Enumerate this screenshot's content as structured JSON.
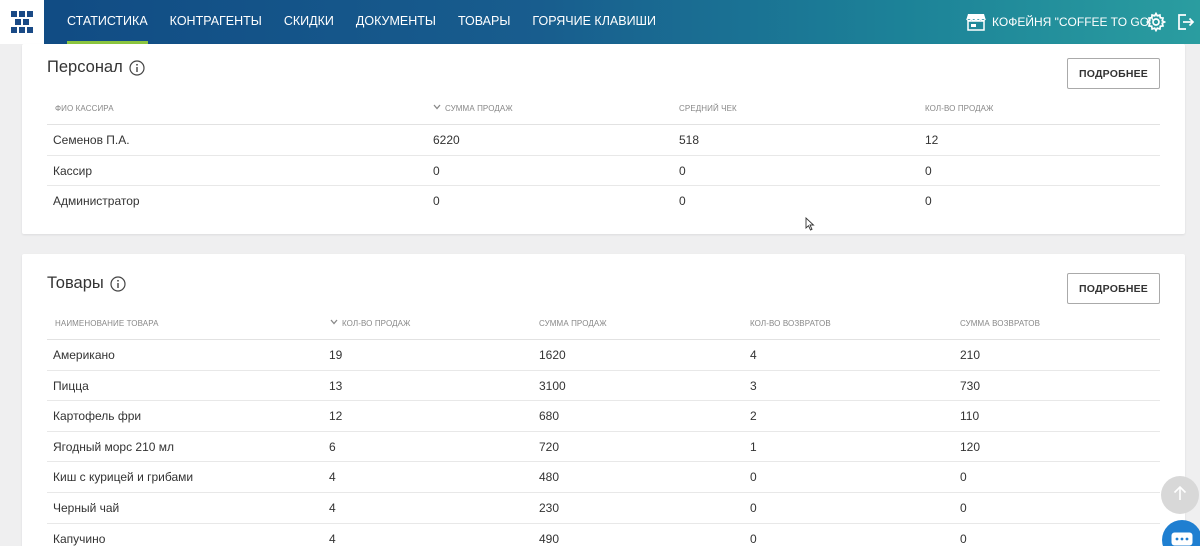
{
  "nav": {
    "items": [
      {
        "label": "СТАТИСТИКА",
        "active": true
      },
      {
        "label": "КОНТРАГЕНТЫ",
        "active": false
      },
      {
        "label": "СКИДКИ",
        "active": false
      },
      {
        "label": "ДОКУМЕНТЫ",
        "active": false
      },
      {
        "label": "ТОВАРЫ",
        "active": false
      },
      {
        "label": "ГОРЯЧИЕ КЛАВИШИ",
        "active": false
      }
    ],
    "store_name": "КОФЕЙНЯ \"COFFEE TO GO\"",
    "icons": {
      "logo": "logo-icon",
      "store": "store-icon",
      "settings": "gear-icon",
      "logout": "logout-icon"
    },
    "colors": {
      "bar_start": "#104a83",
      "bar_end": "#2a9da0",
      "active_underline": "#8bc53f"
    }
  },
  "staff": {
    "title": "Персонал",
    "more_label": "ПОДРОБНЕЕ",
    "columns": [
      "ФИО КАССИРА",
      "СУММА ПРОДАЖ",
      "СРЕДНИЙ ЧЕК",
      "КОЛ-ВО ПРОДАЖ"
    ],
    "sorted_column": "СУММА ПРОДАЖ",
    "rows": [
      [
        "Семенов П.А.",
        "6220",
        "518",
        "12"
      ],
      [
        "Кассир",
        "0",
        "0",
        "0"
      ],
      [
        "Администратор",
        "0",
        "0",
        "0"
      ]
    ]
  },
  "goods": {
    "title": "Товары",
    "more_label": "ПОДРОБНЕЕ",
    "columns": [
      "НАИМЕНОВАНИЕ ТОВАРА",
      "КОЛ-ВО ПРОДАЖ",
      "СУММА ПРОДАЖ",
      "КОЛ-ВО ВОЗВРАТОВ",
      "СУММА ВОЗВРАТОВ"
    ],
    "sorted_column": "КОЛ-ВО ПРОДАЖ",
    "rows": [
      [
        "Американо",
        "19",
        "1620",
        "4",
        "210"
      ],
      [
        "Пицца",
        "13",
        "3100",
        "3",
        "730"
      ],
      [
        "Картофель фри",
        "12",
        "680",
        "2",
        "110"
      ],
      [
        "Ягодный морс 210 мл",
        "6",
        "720",
        "1",
        "120"
      ],
      [
        "Киш с курицей и грибами",
        "4",
        "480",
        "0",
        "0"
      ],
      [
        "Черный чай",
        "4",
        "230",
        "0",
        "0"
      ],
      [
        "Капучино",
        "4",
        "490",
        "0",
        "0"
      ]
    ]
  },
  "widgets": {
    "scroll_top_icon": "arrow-up-icon",
    "chat_icon": "chat-icon",
    "chat_color": "#1f7fd1"
  }
}
